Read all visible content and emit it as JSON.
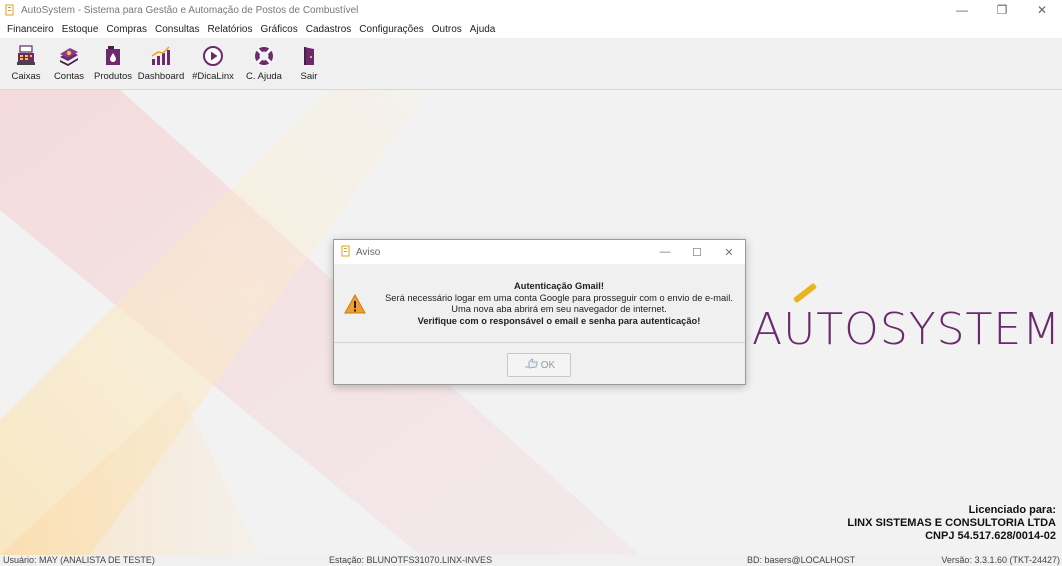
{
  "window": {
    "title": "AutoSystem - Sistema para Gestão e Automação de Postos de Combustível"
  },
  "menu": [
    "Financeiro",
    "Estoque",
    "Compras",
    "Consultas",
    "Relatórios",
    "Gráficos",
    "Cadastros",
    "Configurações",
    "Outros",
    "Ajuda"
  ],
  "toolbar": [
    {
      "label": "Caixas",
      "icon": "cash-register-icon"
    },
    {
      "label": "Contas",
      "icon": "money-stack-icon"
    },
    {
      "label": "Produtos",
      "icon": "fuel-drop-icon"
    },
    {
      "label": "Dashboard",
      "icon": "bar-chart-icon"
    },
    {
      "label": "#DicaLinx",
      "icon": "play-icon"
    },
    {
      "label": "C. Ajuda",
      "icon": "lifebuoy-icon"
    },
    {
      "label": "Sair",
      "icon": "exit-door-icon"
    }
  ],
  "brand": {
    "logo_text": "AUTOSYSTEM",
    "color": "#6b2a6c",
    "accent": "#e8b520"
  },
  "license": {
    "line1": "Licenciado para:",
    "line2": "LINX SISTEMAS E CONSULTORIA LTDA",
    "line3": "CNPJ 54.517.628/0014-02"
  },
  "dialog": {
    "title": "Aviso",
    "heading": "Autenticação Gmail!",
    "line1": "Será necessário logar em uma conta Google para prosseguir com o envio de e-mail.",
    "line2": "Uma nova aba abrirá em seu navegador de internet.",
    "line3": "Verifique com o responsável o email e senha para autenticação!",
    "ok_label": "OK"
  },
  "status": {
    "user": "Usuário: MAY (ANALISTA DE TESTE)",
    "station": "Estação: BLUNOTFS31070.LINX-INVES",
    "db": "BD: basers@LOCALHOST",
    "version": "Versão: 3.3.1.60 (TKT-24427)"
  }
}
